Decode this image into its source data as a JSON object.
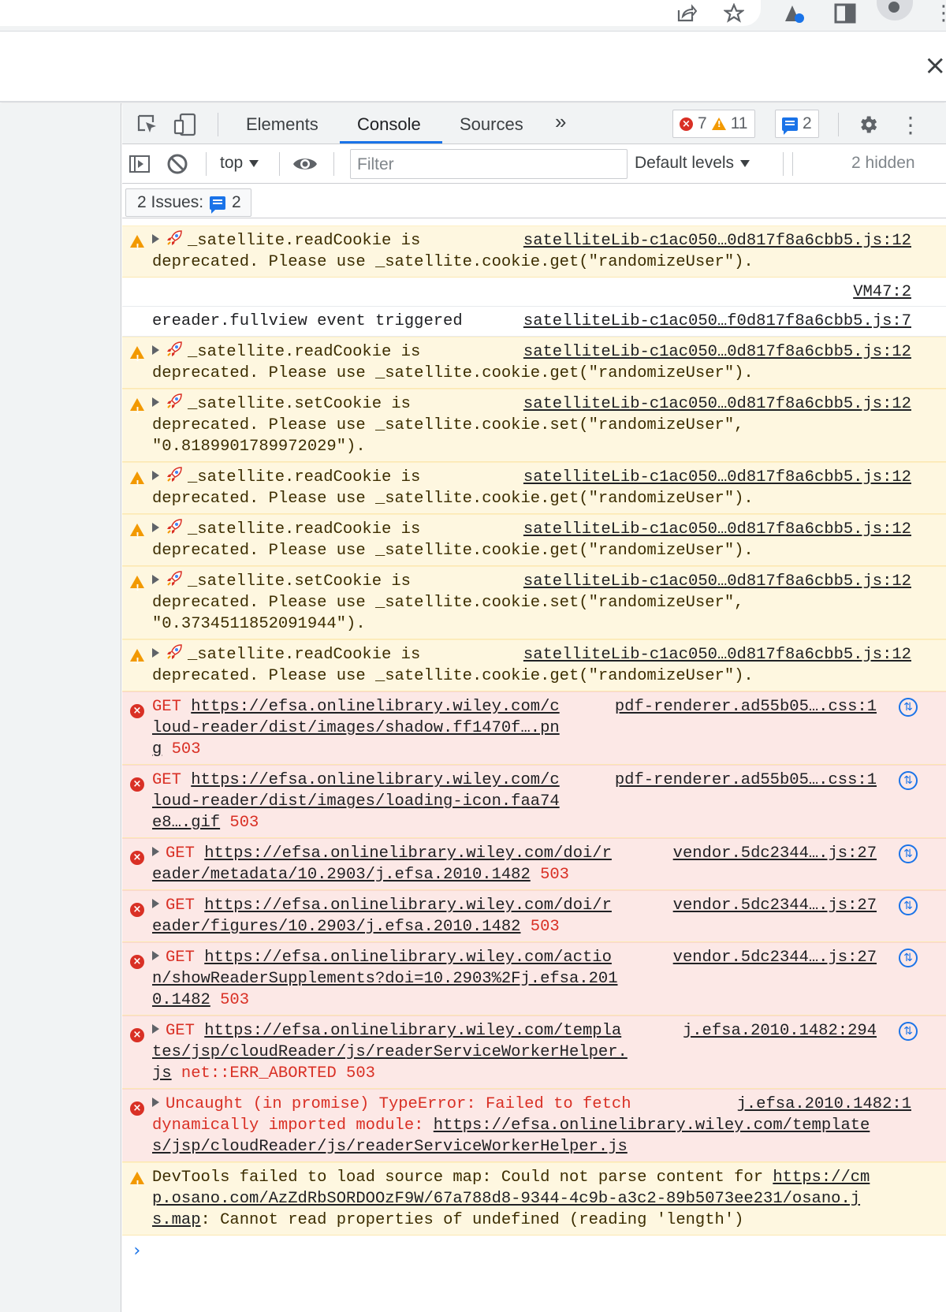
{
  "browser": {
    "close_label": "×"
  },
  "devtools": {
    "tabs": [
      {
        "label": "Elements"
      },
      {
        "label": "Console"
      },
      {
        "label": "Sources"
      }
    ],
    "more_tabs": "»",
    "error_count": "7",
    "warning_count": "11",
    "message_count": "2",
    "context": "top",
    "filter_placeholder": "Filter",
    "levels": "Default levels",
    "hidden": "2 hidden",
    "issues_label": "2 Issues:",
    "issues_count": "2"
  },
  "console": {
    "rows": [
      {
        "kind": "warn",
        "src": "satelliteLib-c1ac050…0d817f8a6cbb5.js:12",
        "lines": [
          "_satellite.readCookie is",
          "deprecated. Please use _satellite.cookie.get(\"randomizeUser\")."
        ]
      },
      {
        "kind": "info-src",
        "src": "VM47:2"
      },
      {
        "kind": "info",
        "src": "satelliteLib-c1ac050…f0d817f8a6cbb5.js:7",
        "lines": [
          "ereader.fullview event triggered"
        ]
      },
      {
        "kind": "warn",
        "src": "satelliteLib-c1ac050…0d817f8a6cbb5.js:12",
        "lines": [
          "_satellite.readCookie is",
          "deprecated. Please use _satellite.cookie.get(\"randomizeUser\")."
        ]
      },
      {
        "kind": "warn",
        "src": "satelliteLib-c1ac050…0d817f8a6cbb5.js:12",
        "lines": [
          "_satellite.setCookie is",
          "deprecated. Please use _satellite.cookie.set(\"randomizeUser\",",
          "\"0.8189901789972029\")."
        ]
      },
      {
        "kind": "warn",
        "src": "satelliteLib-c1ac050…0d817f8a6cbb5.js:12",
        "lines": [
          "_satellite.readCookie is",
          "deprecated. Please use _satellite.cookie.get(\"randomizeUser\")."
        ]
      },
      {
        "kind": "warn",
        "src": "satelliteLib-c1ac050…0d817f8a6cbb5.js:12",
        "lines": [
          "_satellite.readCookie is",
          "deprecated. Please use _satellite.cookie.get(\"randomizeUser\")."
        ]
      },
      {
        "kind": "warn",
        "src": "satelliteLib-c1ac050…0d817f8a6cbb5.js:12",
        "lines": [
          "_satellite.setCookie is",
          "deprecated. Please use _satellite.cookie.set(\"randomizeUser\",",
          "\"0.3734511852091944\")."
        ]
      },
      {
        "kind": "warn",
        "src": "satelliteLib-c1ac050…0d817f8a6cbb5.js:12",
        "lines": [
          "_satellite.readCookie is",
          "deprecated. Please use _satellite.cookie.get(\"randomizeUser\")."
        ]
      },
      {
        "kind": "err",
        "expand": false,
        "src": "pdf-renderer.ad55b05….css:1",
        "prefix": "GET ",
        "link": [
          "https://efsa.onlinelibrary.wiley.com/c",
          "loud-reader/dist/images/shadow.ff1470f….pn",
          "g"
        ],
        "suffix": " 503"
      },
      {
        "kind": "err",
        "expand": false,
        "src": "pdf-renderer.ad55b05….css:1",
        "prefix": "GET ",
        "link": [
          "https://efsa.onlinelibrary.wiley.com/c",
          "loud-reader/dist/images/loading-icon.faa74",
          "e8….gif"
        ],
        "suffix": " 503"
      },
      {
        "kind": "err",
        "expand": true,
        "src": "vendor.5dc2344….js:27",
        "prefix": "GET ",
        "link": [
          "https://efsa.onlinelibrary.wiley.com/doi/r",
          "eader/metadata/10.2903/j.efsa.2010.1482"
        ],
        "suffix": " 503"
      },
      {
        "kind": "err",
        "expand": true,
        "src": "vendor.5dc2344….js:27",
        "prefix": "GET ",
        "link": [
          "https://efsa.onlinelibrary.wiley.com/doi/r",
          "eader/figures/10.2903/j.efsa.2010.1482"
        ],
        "suffix": " 503"
      },
      {
        "kind": "err",
        "expand": true,
        "src": "vendor.5dc2344….js:27",
        "prefix": "GET ",
        "link": [
          "https://efsa.onlinelibrary.wiley.com/actio",
          "n/showReaderSupplements?doi=10.2903%2Fj.efsa.201",
          "0.1482"
        ],
        "suffix": " 503"
      },
      {
        "kind": "err",
        "expand": true,
        "src": "j.efsa.2010.1482:294",
        "prefix": "GET ",
        "link": [
          "https://efsa.onlinelibrary.wiley.com/templa",
          "tes/jsp/cloudReader/js/readerServiceWorkerHelper.",
          "js"
        ],
        "suffix": " net::ERR_ABORTED 503"
      },
      {
        "kind": "err-uncaught",
        "src": "j.efsa.2010.1482:1",
        "line1": "Uncaught (in promise) TypeError: Failed to fetch",
        "line2_prefix": "dynamically imported module: ",
        "link": [
          "https://efsa.onlinelibrary.wiley.com/template",
          "s/jsp/cloudReader/js/readerServiceWorkerHelper.js"
        ]
      },
      {
        "kind": "warn-sourcemap",
        "line1_prefix": "DevTools failed to load source map: Could not parse content for ",
        "link": [
          "https://cm",
          "p.osano.com/AzZdRbSORDOOzF9W/67a788d8-9344-4c9b-a3c2-89b5073ee231/osano.j",
          "s.map"
        ],
        "suffix": ": Cannot read properties of undefined (reading 'length')"
      }
    ],
    "prompt": "›"
  },
  "colors": {
    "accent": "#1a73e8",
    "error": "#d93025",
    "warning": "#f29900",
    "warn_bg": "#fef7e0",
    "err_bg": "#fce8e6"
  }
}
